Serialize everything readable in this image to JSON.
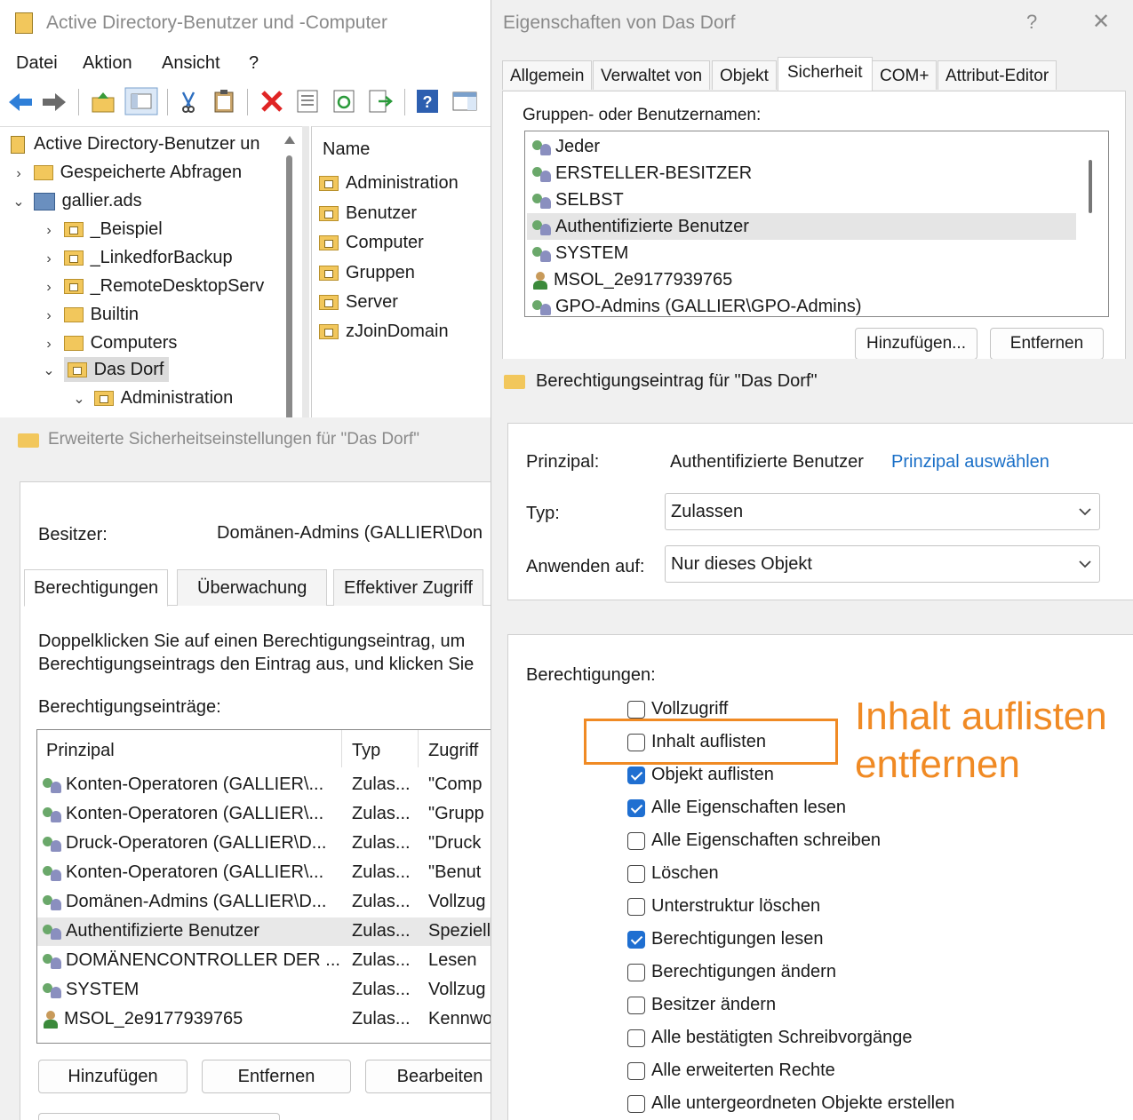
{
  "aduc": {
    "title": "Active Directory-Benutzer und -Computer",
    "menu": [
      "Datei",
      "Aktion",
      "Ansicht",
      "?"
    ],
    "tree": {
      "root": "Active Directory-Benutzer un",
      "items": [
        {
          "label": "Gespeicherte Abfragen",
          "chev": "›"
        },
        {
          "label": "gallier.ads",
          "chev": "⌄"
        },
        {
          "label": "_Beispiel",
          "chev": "›"
        },
        {
          "label": "_LinkedforBackup",
          "chev": "›"
        },
        {
          "label": "_RemoteDesktopServ",
          "chev": "›"
        },
        {
          "label": "Builtin",
          "chev": "›"
        },
        {
          "label": "Computers",
          "chev": "›"
        },
        {
          "label": "Das Dorf",
          "chev": "⌄"
        },
        {
          "label": "Administration",
          "chev": "⌄"
        }
      ]
    },
    "list": {
      "header": "Name",
      "items": [
        "Administration",
        "Benutzer",
        "Computer",
        "Gruppen",
        "Server",
        "zJoinDomain"
      ]
    }
  },
  "props": {
    "title": "Eigenschaften von Das Dorf",
    "help": "?",
    "close": "✕",
    "tabs": [
      "Allgemein",
      "Verwaltet von",
      "Objekt",
      "Sicherheit",
      "COM+",
      "Attribut-Editor"
    ],
    "groups_label": "Gruppen- oder Benutzernamen:",
    "groups": [
      {
        "label": "Jeder",
        "icon": "users"
      },
      {
        "label": "ERSTELLER-BESITZER",
        "icon": "users"
      },
      {
        "label": "SELBST",
        "icon": "users"
      },
      {
        "label": "Authentifizierte Benutzer",
        "icon": "users"
      },
      {
        "label": "SYSTEM",
        "icon": "users"
      },
      {
        "label": "MSOL_2e9177939765",
        "icon": "user"
      },
      {
        "label": "GPO-Admins (GALLIER\\GPO-Admins)",
        "icon": "users"
      }
    ],
    "add_button": "Hinzufügen...",
    "remove_button": "Entfernen"
  },
  "advanced": {
    "title": "Erweiterte Sicherheitseinstellungen für \"Das Dorf\"",
    "owner_label": "Besitzer:",
    "owner_value": "Domänen-Admins (GALLIER\\Don",
    "tabs": [
      "Berechtigungen",
      "Überwachung",
      "Effektiver Zugriff"
    ],
    "info_line1": "Doppelklicken Sie auf einen Berechtigungseintrag, um",
    "info_line2": "Berechtigungseintrags den Eintrag aus, und klicken Sie",
    "entries_label": "Berechtigungseinträge:",
    "columns": [
      "Prinzipal",
      "Typ",
      "Zugriff"
    ],
    "rows": [
      {
        "principal": "Konten-Operatoren (GALLIER\\...",
        "type": "Zulas...",
        "access": "\"Comp",
        "icon": "users"
      },
      {
        "principal": "Konten-Operatoren (GALLIER\\...",
        "type": "Zulas...",
        "access": "\"Grupp",
        "icon": "users"
      },
      {
        "principal": "Druck-Operatoren (GALLIER\\D...",
        "type": "Zulas...",
        "access": "\"Druck",
        "icon": "users"
      },
      {
        "principal": "Konten-Operatoren (GALLIER\\...",
        "type": "Zulas...",
        "access": "\"Benut",
        "icon": "users"
      },
      {
        "principal": "Domänen-Admins (GALLIER\\D...",
        "type": "Zulas...",
        "access": "Vollzug",
        "icon": "users"
      },
      {
        "principal": "Authentifizierte Benutzer",
        "type": "Zulas...",
        "access": "Speziell",
        "icon": "users"
      },
      {
        "principal": "DOMÄNENCONTROLLER DER ...",
        "type": "Zulas...",
        "access": "Lesen",
        "icon": "users"
      },
      {
        "principal": "SYSTEM",
        "type": "Zulas...",
        "access": "Vollzug",
        "icon": "users"
      },
      {
        "principal": "MSOL_2e9177939765",
        "type": "Zulas...",
        "access": "Kennwo",
        "icon": "user"
      }
    ],
    "add_button": "Hinzufügen",
    "remove_button": "Entfernen",
    "edit_button": "Bearbeiten"
  },
  "entry": {
    "title": "Berechtigungseintrag für \"Das Dorf\"",
    "principal_label": "Prinzipal:",
    "principal_value": "Authentifizierte Benutzer",
    "principal_link": "Prinzipal auswählen",
    "type_label": "Typ:",
    "type_value": "Zulassen",
    "apply_label": "Anwenden auf:",
    "apply_value": "Nur dieses Objekt",
    "perms_label": "Berechtigungen:",
    "perms": [
      {
        "label": "Vollzugriff",
        "checked": false
      },
      {
        "label": "Inhalt auflisten",
        "checked": false
      },
      {
        "label": "Objekt auflisten",
        "checked": true
      },
      {
        "label": "Alle Eigenschaften lesen",
        "checked": true
      },
      {
        "label": "Alle Eigenschaften schreiben",
        "checked": false
      },
      {
        "label": "Löschen",
        "checked": false
      },
      {
        "label": "Unterstruktur löschen",
        "checked": false
      },
      {
        "label": "Berechtigungen lesen",
        "checked": true
      },
      {
        "label": "Berechtigungen ändern",
        "checked": false
      },
      {
        "label": "Besitzer ändern",
        "checked": false
      },
      {
        "label": "Alle bestätigten Schreibvorgänge",
        "checked": false
      },
      {
        "label": "Alle erweiterten Rechte",
        "checked": false
      },
      {
        "label": "Alle untergeordneten Objekte erstellen",
        "checked": false
      }
    ]
  },
  "annotation": {
    "line1": "Inhalt auflisten",
    "line2": "entfernen",
    "color": "#f08a24"
  }
}
